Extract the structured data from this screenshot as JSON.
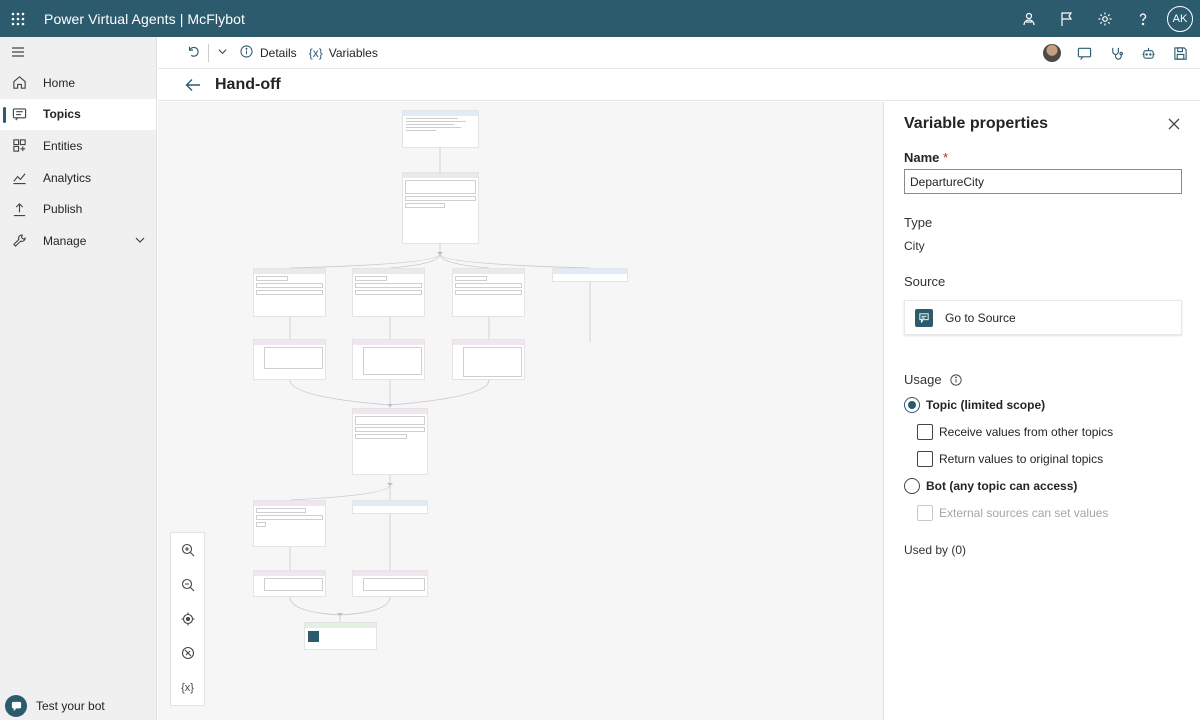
{
  "header": {
    "app_title": "Power Virtual Agents | McFlybot",
    "avatar_initials": "AK"
  },
  "sidebar": {
    "items": [
      {
        "label": "Home",
        "icon": "home-icon"
      },
      {
        "label": "Topics",
        "icon": "chat-icon"
      },
      {
        "label": "Entities",
        "icon": "entities-icon"
      },
      {
        "label": "Analytics",
        "icon": "analytics-icon"
      },
      {
        "label": "Publish",
        "icon": "publish-icon"
      },
      {
        "label": "Manage",
        "icon": "manage-icon"
      }
    ],
    "test_bot_label": "Test your bot"
  },
  "commandbar": {
    "details_label": "Details",
    "variables_label": "Variables",
    "variables_glyph": "{x}"
  },
  "page": {
    "title": "Hand-off"
  },
  "zoom_controls": {
    "variables_glyph": "{x}"
  },
  "panel": {
    "title": "Variable properties",
    "name_label": "Name",
    "required_mark": "*",
    "name_value": "DepartureCity",
    "type_label": "Type",
    "type_value": "City",
    "source_label": "Source",
    "source_link": "Go to Source",
    "usage_label": "Usage",
    "options": {
      "topic_scope": "Topic (limited scope)",
      "receive_values": "Receive values from other topics",
      "return_values": "Return values to original topics",
      "bot_scope": "Bot (any topic can access)",
      "external_sources": "External sources can set values"
    },
    "used_by": "Used by (0)"
  },
  "colors": {
    "brand": "#2d5b6e",
    "required": "#c4262e"
  }
}
